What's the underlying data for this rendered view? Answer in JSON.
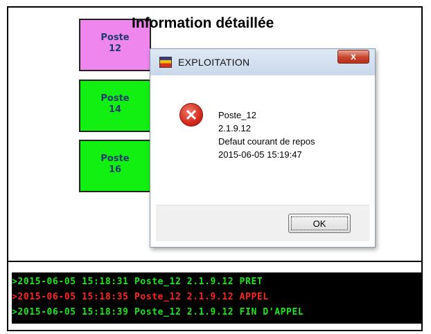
{
  "panel_title": "Information détaillée",
  "postes": [
    {
      "label": "Poste",
      "number": "12",
      "color": "#ee86ee"
    },
    {
      "label": "Poste",
      "number": "14",
      "color": "#11f011"
    },
    {
      "label": "Poste",
      "number": "16",
      "color": "#11f011"
    }
  ],
  "dialog": {
    "title": "EXPLOITATION",
    "close_label": "x",
    "icon": "error-icon",
    "lines": [
      "Poste_12",
      "2.1.9.12",
      "Defaut courant de repos",
      "2015-06-05 15:19:47"
    ],
    "ok_label": "OK"
  },
  "log": [
    {
      "text": ">2015-06-05 15:18:31 Poste_12 2.1.9.12 PRET",
      "color": "#17e817"
    },
    {
      "text": ">2015-06-05 15:18:35 Poste_12 2.1.9.12 APPEL",
      "color": "#ff2222"
    },
    {
      "text": ">2015-06-05 15:18:39 Poste_12 2.1.9.12 FIN D'APPEL",
      "color": "#17e817"
    }
  ]
}
